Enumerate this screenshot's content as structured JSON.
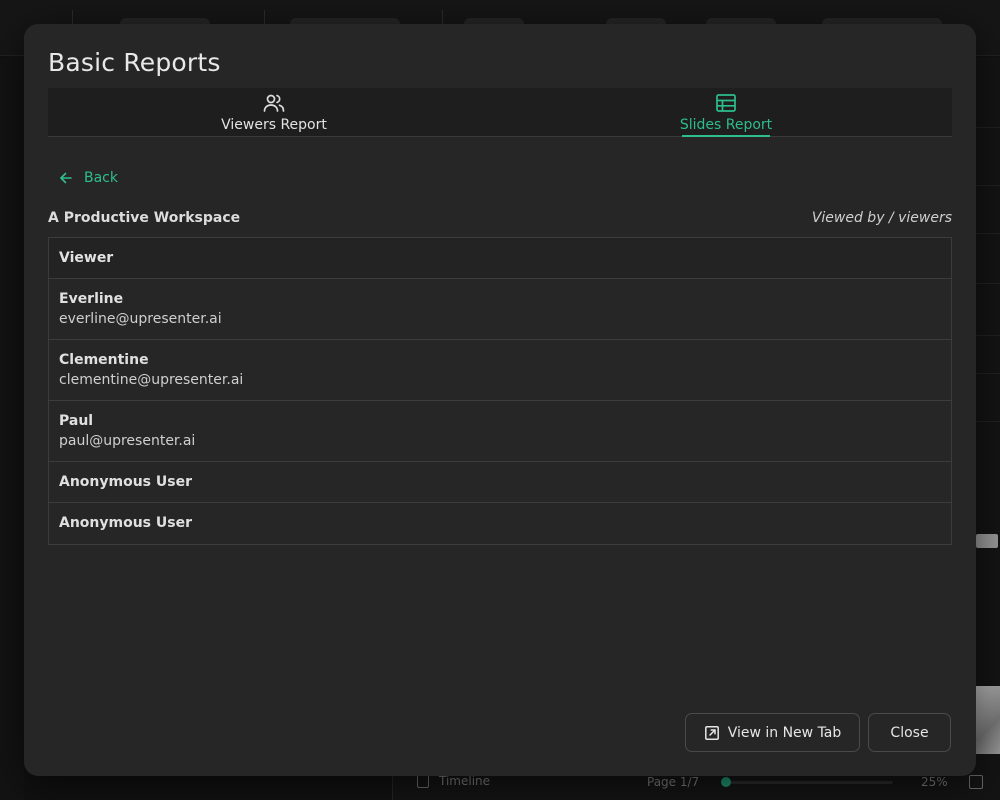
{
  "modal": {
    "title": "Basic Reports",
    "tabs": [
      {
        "label": "Viewers Report",
        "icon": "users-icon",
        "active": false
      },
      {
        "label": "Slides Report",
        "icon": "table-icon",
        "active": true
      }
    ],
    "back_label": "Back",
    "slide_title": "A Productive Workspace",
    "viewed_by": "Viewed by / viewers",
    "table": {
      "header": "Viewer",
      "rows": [
        {
          "name": "Everline",
          "email": "everline@upresenter.ai"
        },
        {
          "name": "Clementine",
          "email": "clementine@upresenter.ai"
        },
        {
          "name": "Paul",
          "email": "paul@upresenter.ai"
        },
        {
          "name": "Anonymous User",
          "email": ""
        },
        {
          "name": "Anonymous User",
          "email": ""
        }
      ]
    },
    "buttons": {
      "view_new_tab": "View in New Tab",
      "close": "Close"
    }
  },
  "background": {
    "timeline_label": "Timeline",
    "page_label": "Page 1/7",
    "zoom_label": "25%",
    "zoom_fraction": 0.0
  },
  "colors": {
    "accent": "#2ebd8c",
    "modal_bg": "#262626",
    "border": "#3c3c3c"
  }
}
